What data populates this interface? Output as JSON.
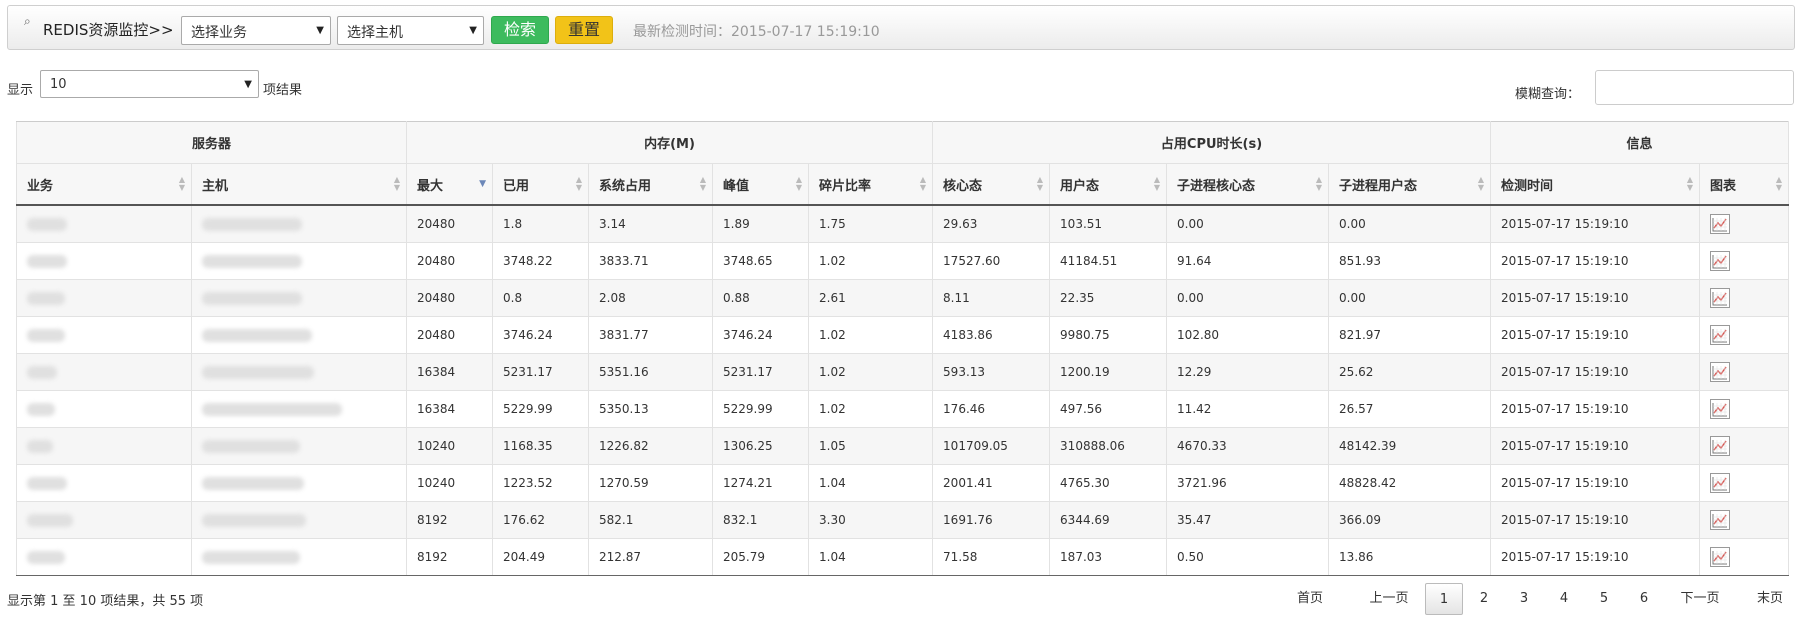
{
  "toolbar": {
    "icon": "search-icon",
    "title": "REDIS资源监控>>",
    "business_select": "选择业务",
    "host_select": "选择主机",
    "search_button": "检索",
    "reset_button": "重置",
    "last_check": "最新检测时间：2015-07-17 15:19:10"
  },
  "controls": {
    "show_label": "显示",
    "page_length": "10",
    "results_label": "项结果",
    "fuzzy_label": "模糊查询：",
    "fuzzy_value": ""
  },
  "table": {
    "groups": {
      "server": "服务器",
      "memory": "内存(M)",
      "cpu": "占用CPU时长(s)",
      "info": "信息"
    },
    "columns": [
      "业务",
      "主机",
      "最大",
      "已用",
      "系统占用",
      "峰值",
      "碎片比率",
      "核心态",
      "用户态",
      "子进程核心态",
      "子进程用户态",
      "检测时间",
      "图表"
    ],
    "rows": [
      {
        "max": "20480",
        "used": "1.8",
        "sys": "3.14",
        "peak": "1.89",
        "frag": "1.75",
        "kernel": "29.63",
        "user": "103.51",
        "child_kernel": "0.00",
        "child_user": "0.00",
        "time": "2015-07-17 15:19:10"
      },
      {
        "max": "20480",
        "used": "3748.22",
        "sys": "3833.71",
        "peak": "3748.65",
        "frag": "1.02",
        "kernel": "17527.60",
        "user": "41184.51",
        "child_kernel": "91.64",
        "child_user": "851.93",
        "time": "2015-07-17 15:19:10"
      },
      {
        "max": "20480",
        "used": "0.8",
        "sys": "2.08",
        "peak": "0.88",
        "frag": "2.61",
        "kernel": "8.11",
        "user": "22.35",
        "child_kernel": "0.00",
        "child_user": "0.00",
        "time": "2015-07-17 15:19:10"
      },
      {
        "max": "20480",
        "used": "3746.24",
        "sys": "3831.77",
        "peak": "3746.24",
        "frag": "1.02",
        "kernel": "4183.86",
        "user": "9980.75",
        "child_kernel": "102.80",
        "child_user": "821.97",
        "time": "2015-07-17 15:19:10"
      },
      {
        "max": "16384",
        "used": "5231.17",
        "sys": "5351.16",
        "peak": "5231.17",
        "frag": "1.02",
        "kernel": "593.13",
        "user": "1200.19",
        "child_kernel": "12.29",
        "child_user": "25.62",
        "time": "2015-07-17 15:19:10"
      },
      {
        "max": "16384",
        "used": "5229.99",
        "sys": "5350.13",
        "peak": "5229.99",
        "frag": "1.02",
        "kernel": "176.46",
        "user": "497.56",
        "child_kernel": "11.42",
        "child_user": "26.57",
        "time": "2015-07-17 15:19:10"
      },
      {
        "max": "10240",
        "used": "1168.35",
        "sys": "1226.82",
        "peak": "1306.25",
        "frag": "1.05",
        "kernel": "101709.05",
        "user": "310888.06",
        "child_kernel": "4670.33",
        "child_user": "48142.39",
        "time": "2015-07-17 15:19:10"
      },
      {
        "max": "10240",
        "used": "1223.52",
        "sys": "1270.59",
        "peak": "1274.21",
        "frag": "1.04",
        "kernel": "2001.41",
        "user": "4765.30",
        "child_kernel": "3721.96",
        "child_user": "48828.42",
        "time": "2015-07-17 15:19:10"
      },
      {
        "max": "8192",
        "used": "176.62",
        "sys": "582.1",
        "peak": "832.1",
        "frag": "3.30",
        "kernel": "1691.76",
        "user": "6344.69",
        "child_kernel": "35.47",
        "child_user": "366.09",
        "time": "2015-07-17 15:19:10"
      },
      {
        "max": "8192",
        "used": "204.49",
        "sys": "212.87",
        "peak": "205.79",
        "frag": "1.04",
        "kernel": "71.58",
        "user": "187.03",
        "child_kernel": "0.50",
        "child_user": "13.86",
        "time": "2015-07-17 15:19:10"
      }
    ],
    "chart_icon": "line-chart-icon"
  },
  "footer": {
    "info": "显示第 1 至 10 项结果，共 55 项",
    "first": "首页",
    "prev": "上一页",
    "pages": [
      "1",
      "2",
      "3",
      "4",
      "5",
      "6"
    ],
    "active_page": "1",
    "next": "下一页",
    "last": "末页"
  }
}
